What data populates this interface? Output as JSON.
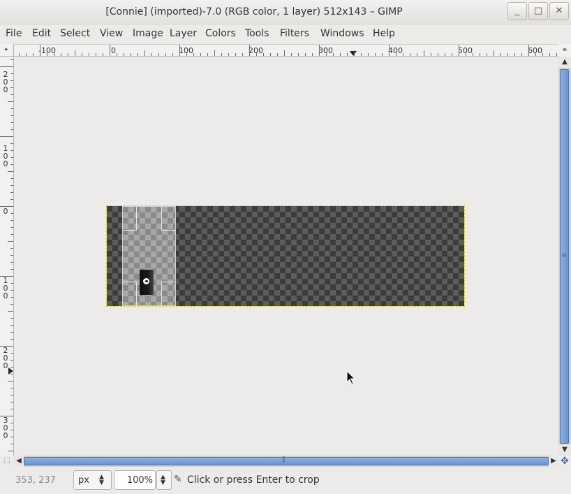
{
  "window": {
    "title": "[Connie] (imported)-7.0 (RGB color, 1 layer) 512x143 – GIMP",
    "minimize_icon": "minimize-icon",
    "maximize_icon": "maximize-icon",
    "close_icon": "close-icon"
  },
  "menubar": {
    "items": [
      "File",
      "Edit",
      "Select",
      "View",
      "Image",
      "Layer",
      "Colors",
      "Tools",
      "Filters",
      "Windows",
      "Help"
    ]
  },
  "rulers": {
    "horizontal_labels": [
      "-100",
      "0",
      "100",
      "200",
      "300",
      "400",
      "500",
      "600"
    ],
    "vertical_labels": [
      [
        "2",
        "0",
        "0"
      ],
      [
        "1",
        "0",
        "0"
      ],
      [
        "0"
      ],
      [
        "1",
        "0",
        "0"
      ],
      [
        "2",
        "0",
        "0"
      ],
      [
        "3",
        "0",
        "0"
      ]
    ]
  },
  "image": {
    "width": 512,
    "height": 143,
    "background": "checkerboard-transparent"
  },
  "statusbar": {
    "pointer_coords": "353, 237",
    "unit": "px",
    "zoom": "100%",
    "message": "Click or press Enter to crop",
    "tool_icon": "crop-tool-icon"
  },
  "colors": {
    "scrollbar_thumb": "#6a95d2",
    "selection_outline": "#d8d800"
  }
}
